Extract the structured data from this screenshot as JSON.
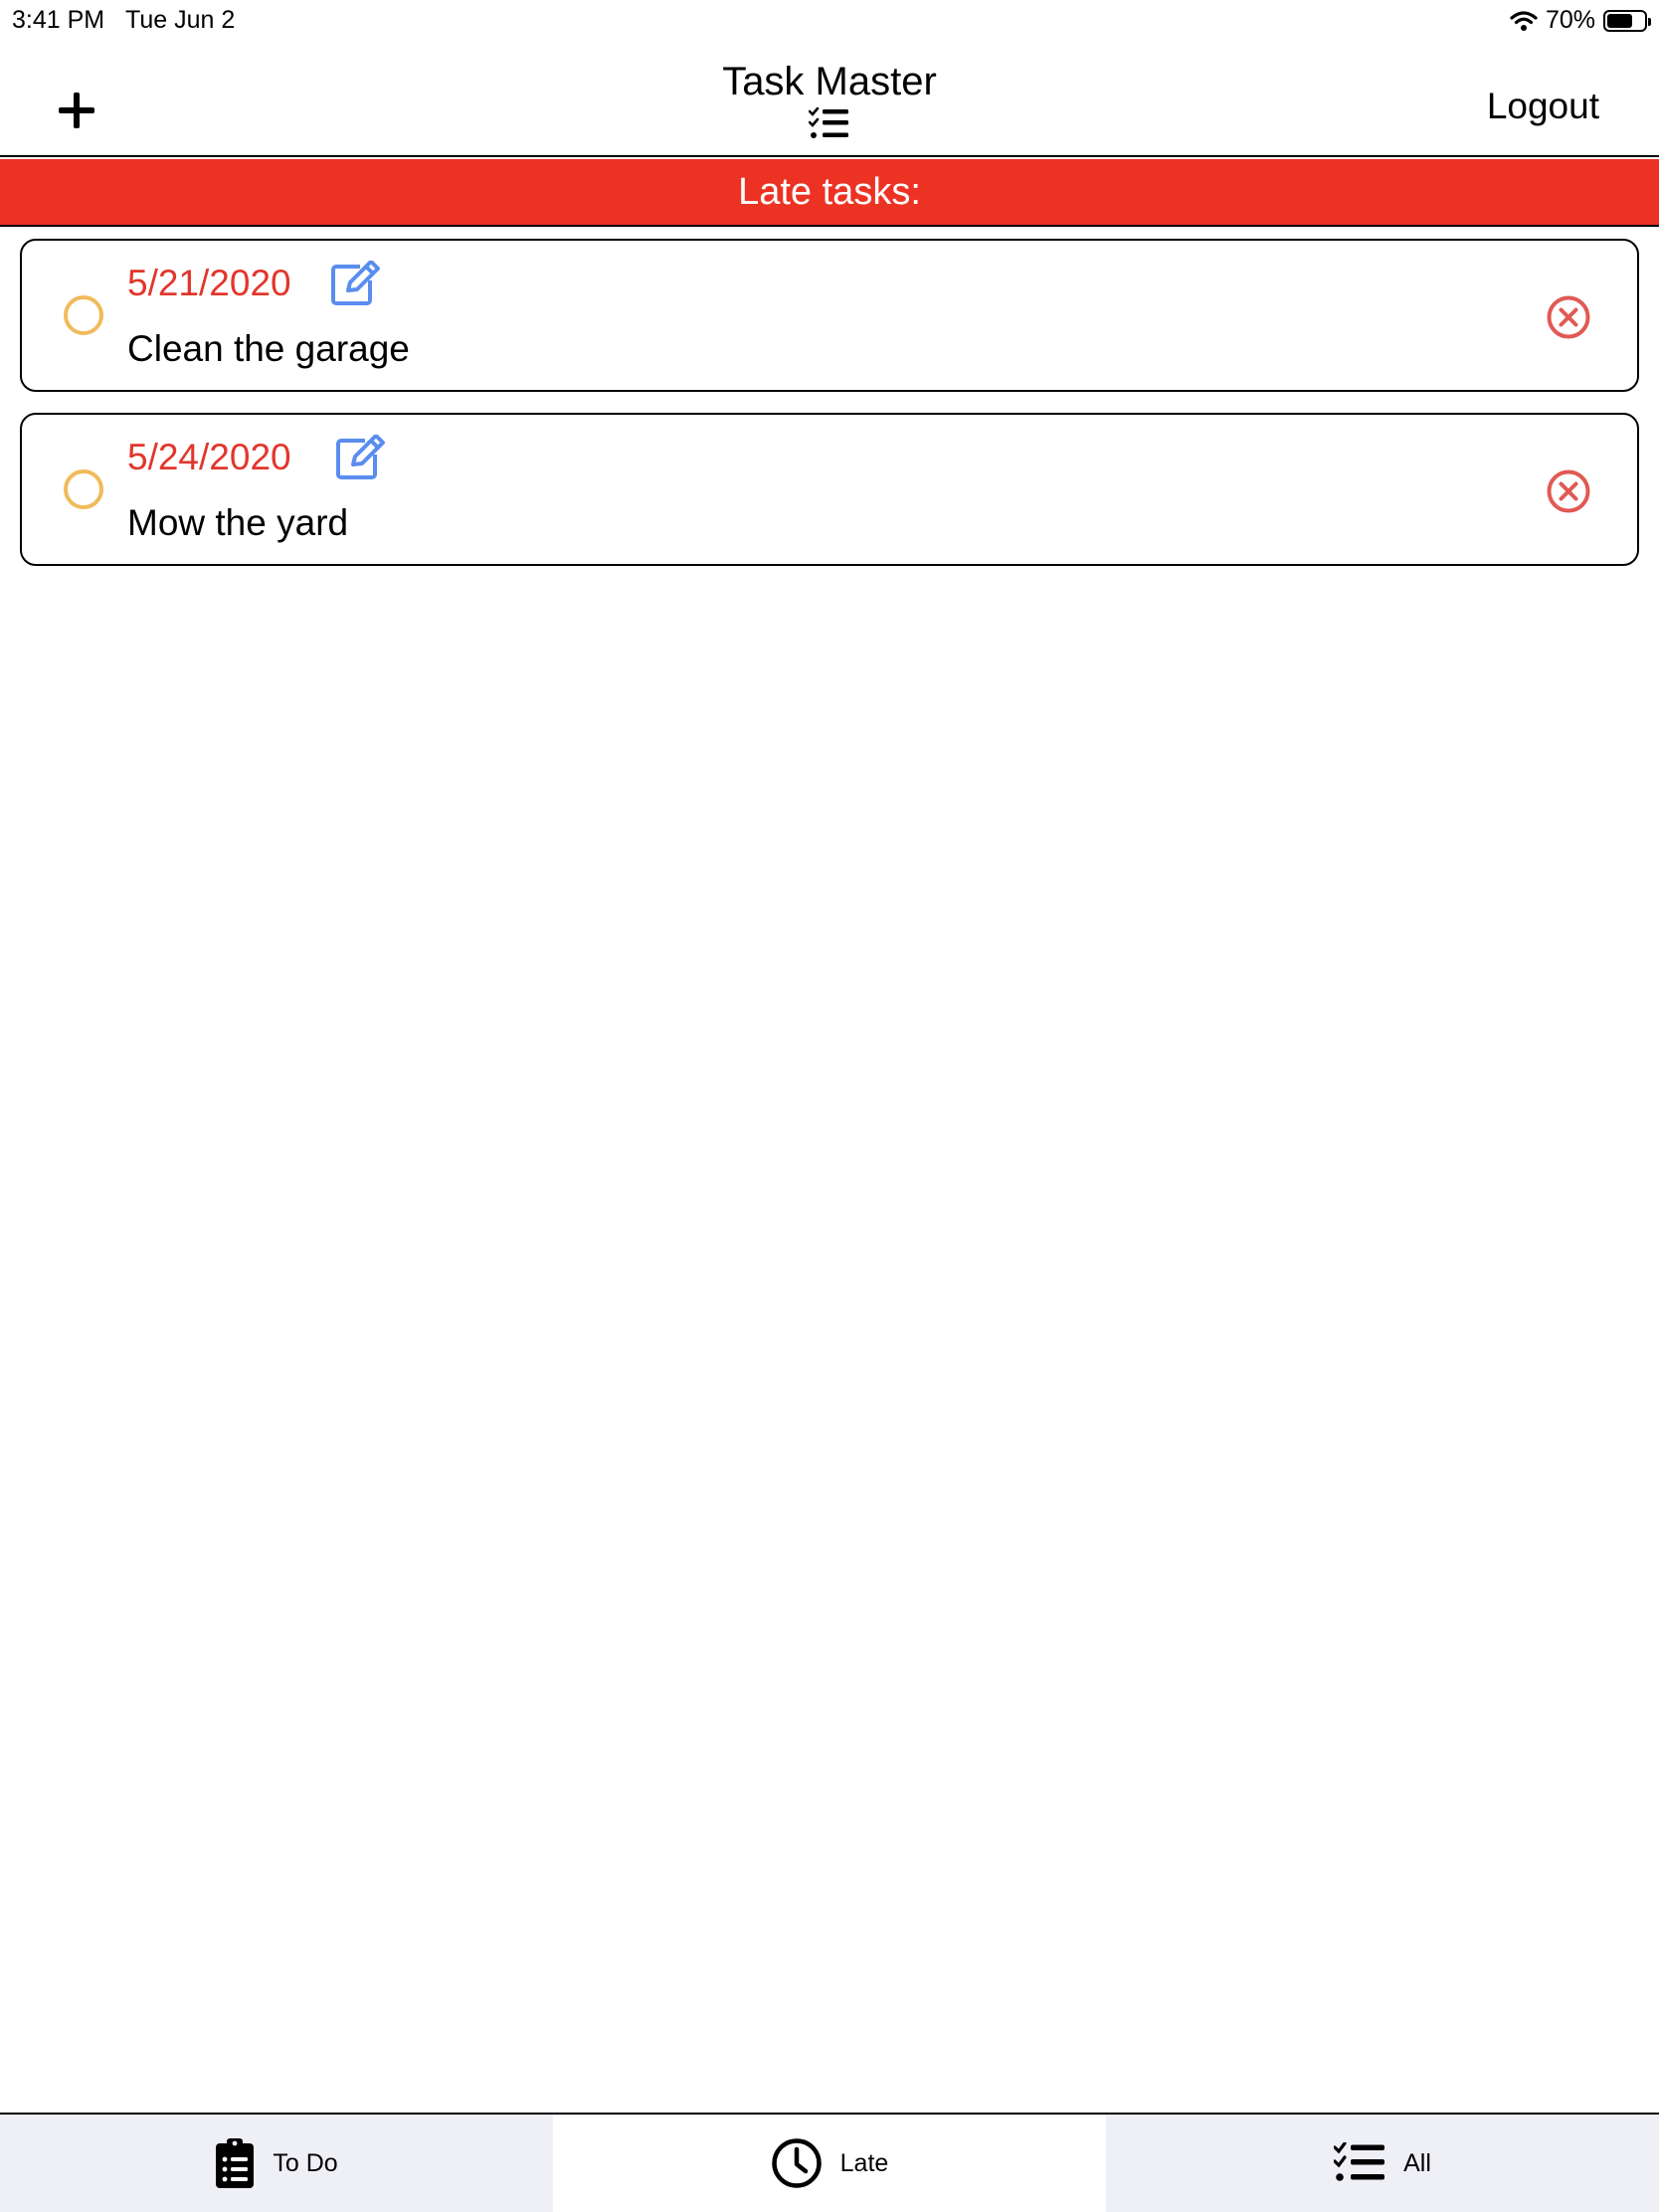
{
  "status_bar": {
    "time": "3:41 PM",
    "date": "Tue Jun 2",
    "battery": "70%",
    "battery_level": 0.7
  },
  "header": {
    "title": "Task Master",
    "logout_label": "Logout",
    "add_icon": "plus-icon",
    "title_icon": "checklist-icon"
  },
  "banner": {
    "label": "Late tasks:",
    "color": "#ec3323"
  },
  "tasks": [
    {
      "date": "5/21/2020",
      "text": "Clean the garage"
    },
    {
      "date": "5/24/2020",
      "text": "Mow the yard"
    }
  ],
  "colors": {
    "late_date": "#e2362c",
    "edit_icon": "#5b8def",
    "delete_icon": "#e05a54",
    "complete_toggle": "#f0bb5b"
  },
  "tabs": [
    {
      "label": "To Do",
      "icon": "clipboard-list-icon",
      "active": false
    },
    {
      "label": "Late",
      "icon": "clock-icon",
      "active": true
    },
    {
      "label": "All",
      "icon": "checklist-icon",
      "active": false
    }
  ]
}
